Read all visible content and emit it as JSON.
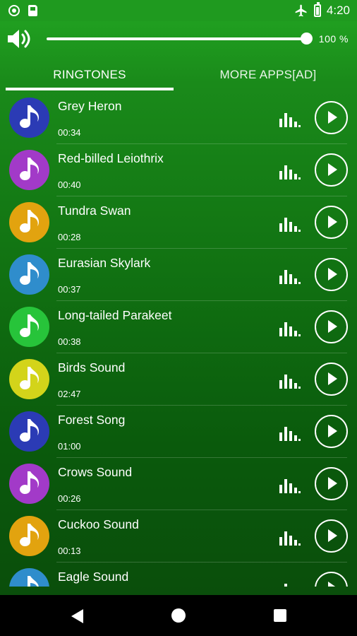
{
  "status_bar": {
    "time": "4:20",
    "icons": [
      "record-icon",
      "sd-card-icon",
      "airplane-mode-icon",
      "battery-icon"
    ]
  },
  "volume": {
    "icon": "speaker-icon",
    "level_percent": 100,
    "label": "100 %"
  },
  "tabs": {
    "items": [
      {
        "label": "RINGTONES",
        "selected": true
      },
      {
        "label": "MORE APPS[AD]",
        "selected": false
      }
    ]
  },
  "colors": {
    "blue": "#2b3bb5",
    "purple": "#a23ac8",
    "amber": "#e2a30f",
    "sky": "#2f8dcc",
    "green": "#27c43a",
    "yellow": "#d3d41a"
  },
  "ringtones": [
    {
      "title": "Grey Heron",
      "duration": "00:34",
      "color": "#2b3bb5"
    },
    {
      "title": "Red-billed Leiothrix",
      "duration": "00:40",
      "color": "#a23ac8"
    },
    {
      "title": "Tundra Swan",
      "duration": "00:28",
      "color": "#e2a30f"
    },
    {
      "title": "Eurasian Skylark",
      "duration": "00:37",
      "color": "#2f8dcc"
    },
    {
      "title": "Long-tailed Parakeet",
      "duration": "00:38",
      "color": "#27c43a"
    },
    {
      "title": "Birds Sound",
      "duration": "02:47",
      "color": "#d3d41a"
    },
    {
      "title": "Forest Song",
      "duration": "01:00",
      "color": "#2b3bb5"
    },
    {
      "title": "Crows Sound",
      "duration": "00:26",
      "color": "#a23ac8"
    },
    {
      "title": "Cuckoo Sound",
      "duration": "00:13",
      "color": "#e2a30f"
    },
    {
      "title": "Eagle Sound",
      "duration": "",
      "color": "#2f8dcc"
    }
  ],
  "nav_bar": {
    "icons": [
      "back-icon",
      "home-icon",
      "recents-icon"
    ]
  }
}
